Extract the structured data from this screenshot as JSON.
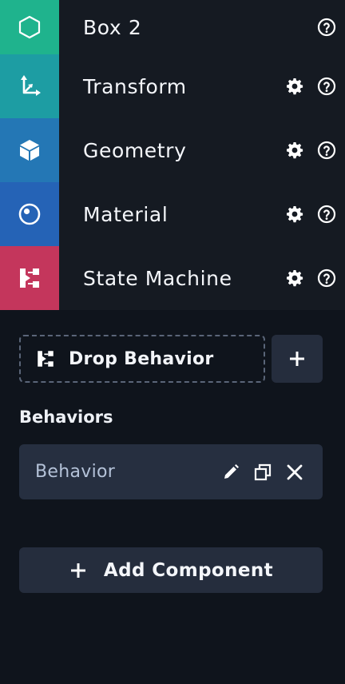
{
  "components": [
    {
      "label": "Box 2",
      "icon": "hexagon-icon",
      "color": "#1fb38d",
      "has_settings": false
    },
    {
      "label": "Transform",
      "icon": "transform-axes-icon",
      "color": "#1d9da3",
      "has_settings": true
    },
    {
      "label": "Geometry",
      "icon": "cube-icon",
      "color": "#2477b5",
      "has_settings": true
    },
    {
      "label": "Material",
      "icon": "material-sphere-icon",
      "color": "#2563b6",
      "has_settings": true
    },
    {
      "label": "State Machine",
      "icon": "state-machine-icon",
      "color": "#c4365c",
      "has_settings": true
    }
  ],
  "behaviors": {
    "drop_label": "Drop Behavior",
    "section_title": "Behaviors",
    "items": [
      {
        "name": "Behavior"
      }
    ]
  },
  "add_component_label": "Add Component",
  "colors": {
    "background": "#0f141c",
    "list_background": "#151a22",
    "button_background": "#252d3d",
    "card_background": "#262f40",
    "dashed_border": "#5a6578"
  }
}
